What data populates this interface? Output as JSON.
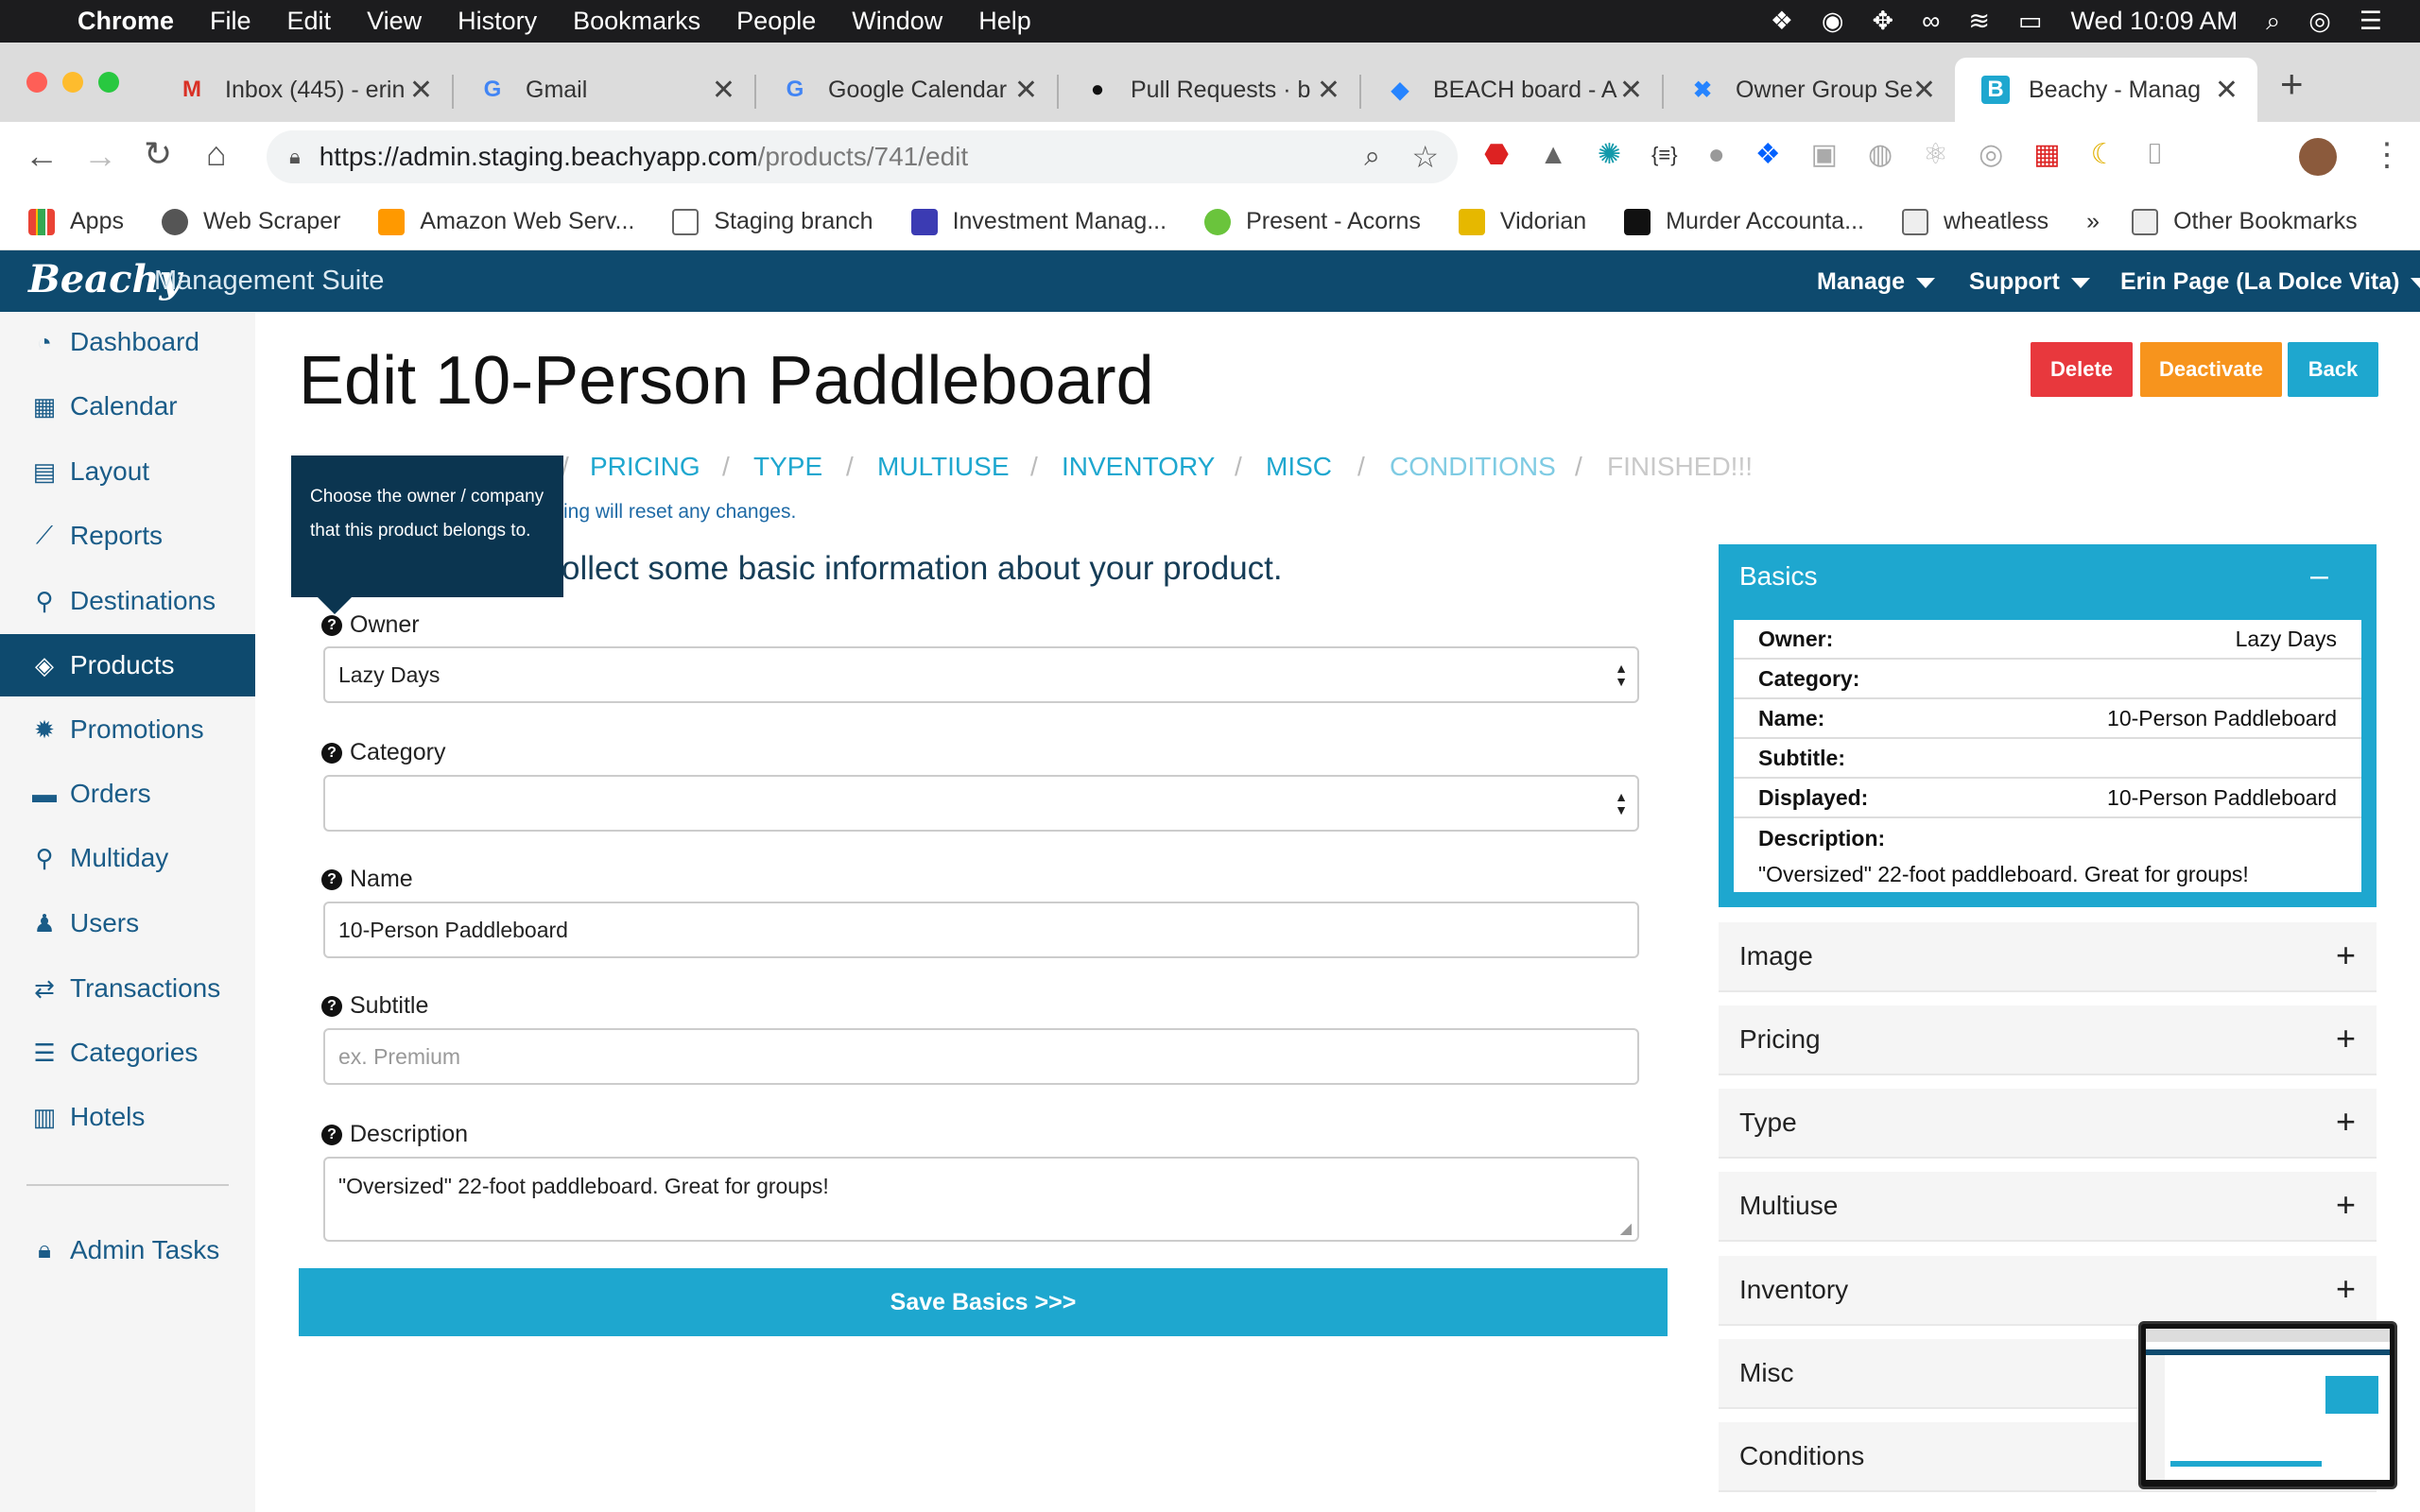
{
  "macbar": {
    "app": "Chrome",
    "menus": [
      "File",
      "Edit",
      "View",
      "History",
      "Bookmarks",
      "People",
      "Window",
      "Help"
    ],
    "clock": "Wed 10:09 AM"
  },
  "tabs": [
    {
      "title": "Inbox (445) - erin",
      "icon": "gmail-icon"
    },
    {
      "title": "Gmail",
      "icon": "google-icon"
    },
    {
      "title": "Google Calendar",
      "icon": "google-icon"
    },
    {
      "title": "Pull Requests · b",
      "icon": "github-icon"
    },
    {
      "title": "BEACH board - A",
      "icon": "jira-icon"
    },
    {
      "title": "Owner Group Se",
      "icon": "confluence-icon"
    },
    {
      "title": "Beachy - Manag",
      "icon": "beachy-icon"
    }
  ],
  "address": {
    "host": "https://admin.staging.beachyapp.com",
    "path": "/products/741/edit"
  },
  "bookmarks": [
    "Apps",
    "Web Scraper",
    "Amazon Web Serv...",
    "Staging branch",
    "Investment Manag...",
    "Present - Acorns",
    "Vidorian",
    "Murder Accounta...",
    "wheatless",
    "»",
    "Other Bookmarks"
  ],
  "app": {
    "brand": "Beachy",
    "suite": "Management Suite",
    "nav": {
      "manage": "Manage",
      "support": "Support",
      "user": "Erin Page (La Dolce Vita)"
    }
  },
  "sidebar": {
    "items": [
      {
        "label": "Dashboard",
        "icon": "dashboard-icon"
      },
      {
        "label": "Calendar",
        "icon": "calendar-icon"
      },
      {
        "label": "Layout",
        "icon": "grid-icon"
      },
      {
        "label": "Reports",
        "icon": "chart-icon"
      },
      {
        "label": "Destinations",
        "icon": "map-pin-icon"
      },
      {
        "label": "Products",
        "icon": "tag-icon"
      },
      {
        "label": "Promotions",
        "icon": "badge-icon"
      },
      {
        "label": "Orders",
        "icon": "credit-card-icon"
      },
      {
        "label": "Multiday",
        "icon": "search-icon"
      },
      {
        "label": "Users",
        "icon": "user-icon"
      },
      {
        "label": "Transactions",
        "icon": "exchange-icon"
      },
      {
        "label": "Categories",
        "icon": "list-icon"
      },
      {
        "label": "Hotels",
        "icon": "building-icon"
      }
    ],
    "admin": "Admin Tasks"
  },
  "page": {
    "title": "Edit 10-Person Paddleboard",
    "buttons": {
      "delete": "Delete",
      "deactivate": "Deactivate",
      "back": "Back"
    },
    "steps": [
      "PRICING",
      "TYPE",
      "MULTIUSE",
      "INVENTORY",
      "MISC",
      "CONDITIONS",
      "FINISHED!!!"
    ],
    "note": "ing will reset any changes.",
    "intro": "ollect some basic information about your product.",
    "tooltip": "Choose the owner / company that this product belongs to."
  },
  "form": {
    "owner": {
      "label": "Owner",
      "value": "Lazy Days"
    },
    "category": {
      "label": "Category",
      "value": ""
    },
    "name": {
      "label": "Name",
      "value": "10-Person Paddleboard"
    },
    "subtitle": {
      "label": "Subtitle",
      "placeholder": "ex. Premium"
    },
    "description": {
      "label": "Description",
      "value": "\"Oversized\" 22-foot paddleboard. Great for groups!"
    },
    "save": "Save Basics >>>"
  },
  "panel": {
    "basics_title": "Basics",
    "collapse": "–",
    "rows": [
      {
        "k": "Owner:",
        "v": "Lazy Days"
      },
      {
        "k": "Category:",
        "v": ""
      },
      {
        "k": "Name:",
        "v": "10-Person Paddleboard"
      },
      {
        "k": "Subtitle:",
        "v": ""
      },
      {
        "k": "Displayed:",
        "v": "10-Person Paddleboard"
      },
      {
        "k": "Description:",
        "v": ""
      }
    ],
    "description_value": "\"Oversized\" 22-foot paddleboard. Great for groups!",
    "sections": [
      "Image",
      "Pricing",
      "Type",
      "Multiuse",
      "Inventory",
      "Misc",
      "Conditions"
    ],
    "expand": "+"
  },
  "colors": {
    "navy": "#0e4a6e",
    "accent": "#1ea7cf",
    "delete": "#e8383d",
    "deactivate": "#f7941d"
  }
}
